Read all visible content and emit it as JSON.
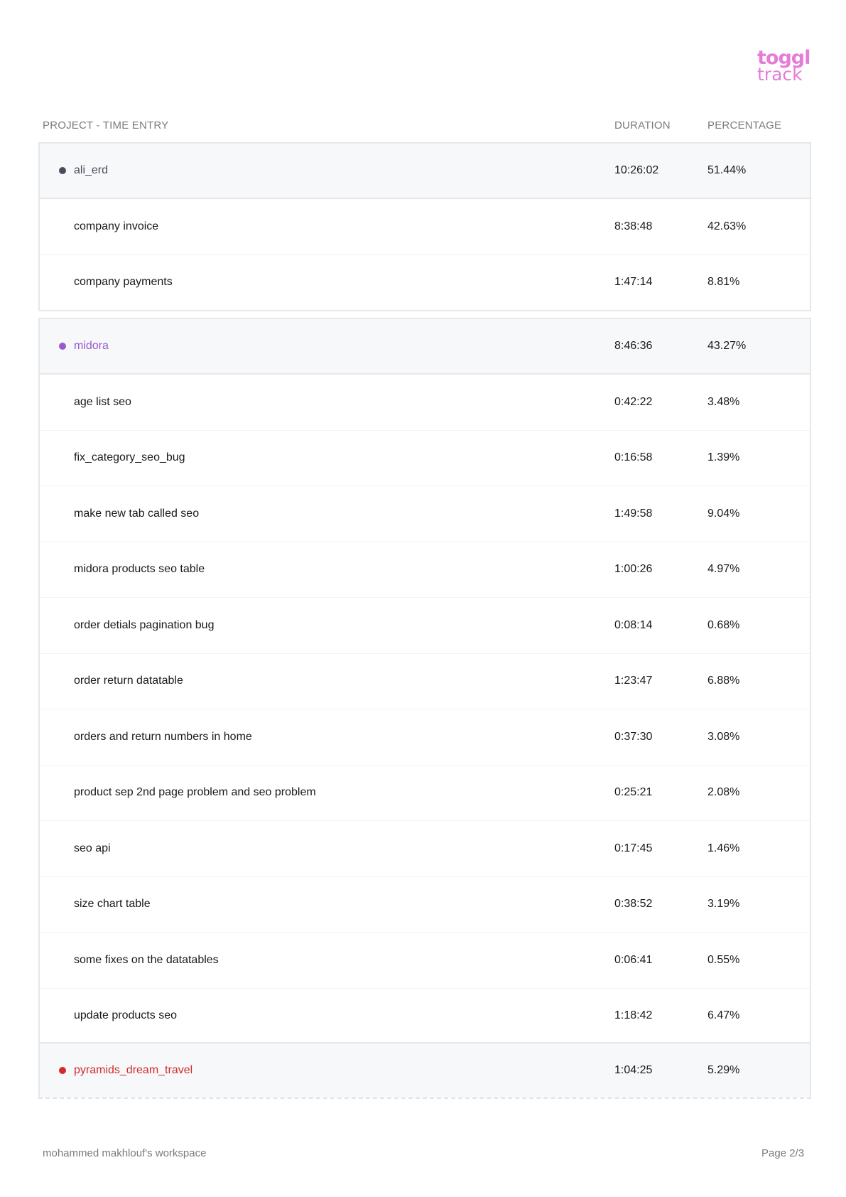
{
  "logo": {
    "line1": "toggl",
    "line2": "track",
    "color": "#e57cd8"
  },
  "table": {
    "headers": {
      "project": "PROJECT - TIME ENTRY",
      "duration": "DURATION",
      "percentage": "PERCENTAGE"
    }
  },
  "projects": [
    {
      "name": "ali_erd",
      "color": "#4b4b5e",
      "duration": "10:26:02",
      "percentage": "51.44%",
      "entries": [
        {
          "name": "company invoice",
          "duration": "8:38:48",
          "percentage": "42.63%"
        },
        {
          "name": "company payments",
          "duration": "1:47:14",
          "percentage": "8.81%"
        }
      ]
    },
    {
      "name": "midora",
      "color": "#9b59d0",
      "duration": "8:46:36",
      "percentage": "43.27%",
      "entries": [
        {
          "name": "age list seo",
          "duration": "0:42:22",
          "percentage": "3.48%"
        },
        {
          "name": "fix_category_seo_bug",
          "duration": "0:16:58",
          "percentage": "1.39%"
        },
        {
          "name": "make new tab called seo",
          "duration": "1:49:58",
          "percentage": "9.04%"
        },
        {
          "name": "midora products seo table",
          "duration": "1:00:26",
          "percentage": "4.97%"
        },
        {
          "name": "order detials pagination bug",
          "duration": "0:08:14",
          "percentage": "0.68%"
        },
        {
          "name": "order return datatable",
          "duration": "1:23:47",
          "percentage": "6.88%"
        },
        {
          "name": "orders and return numbers in home",
          "duration": "0:37:30",
          "percentage": "3.08%"
        },
        {
          "name": "product sep 2nd page problem and seo problem",
          "duration": "0:25:21",
          "percentage": "2.08%"
        },
        {
          "name": "seo api",
          "duration": "0:17:45",
          "percentage": "1.46%"
        },
        {
          "name": "size chart table",
          "duration": "0:38:52",
          "percentage": "3.19%"
        },
        {
          "name": "some fixes on the datatables",
          "duration": "0:06:41",
          "percentage": "0.55%"
        },
        {
          "name": "update products seo",
          "duration": "1:18:42",
          "percentage": "6.47%"
        }
      ]
    },
    {
      "name": "pyramids_dream_travel",
      "color": "#d42a2a",
      "duration": "1:04:25",
      "percentage": "5.29%",
      "entries": []
    }
  ],
  "footer": {
    "workspace": "mohammed makhlouf's workspace",
    "page": "Page 2/3"
  }
}
